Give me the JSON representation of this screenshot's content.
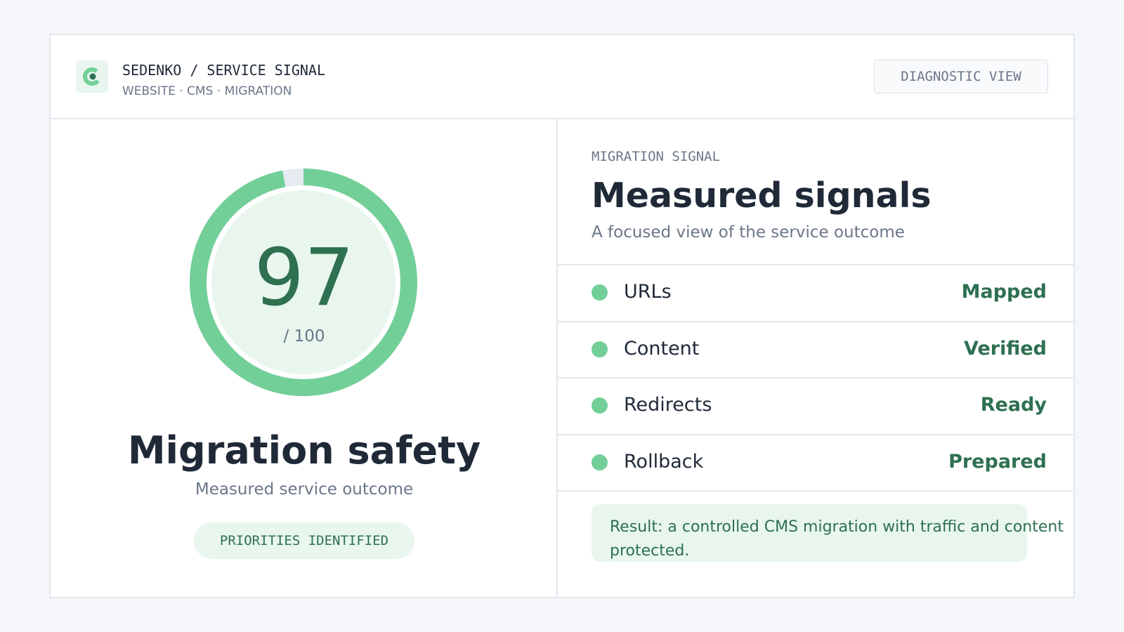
{
  "header": {
    "brand_title": "SEDENKO / SERVICE SIGNAL",
    "brand_subtitle": "WEBSITE · CMS · MIGRATION",
    "diagnostic_button": "DIAGNOSTIC VIEW"
  },
  "score": {
    "value": "97",
    "max_label": "/ 100",
    "fraction": 0.97,
    "title": "Migration safety",
    "subtitle": "Measured service outcome",
    "badge": "PRIORITIES IDENTIFIED"
  },
  "signals_panel": {
    "eyebrow": "MIGRATION SIGNAL",
    "title": "Measured signals",
    "subtitle": "A focused view of the service outcome",
    "rows": [
      {
        "label": "URLs",
        "value": "Mapped"
      },
      {
        "label": "Content",
        "value": "Verified"
      },
      {
        "label": "Redirects",
        "value": "Ready"
      },
      {
        "label": "Rollback",
        "value": "Prepared"
      }
    ],
    "result_line1": "Result: a controlled CMS migration with traffic and content",
    "result_line2": "protected."
  },
  "colors": {
    "accent": "#72cf98",
    "accent_dark": "#2e7050",
    "accent_soft": "#e8f6ee",
    "track": "#e5ebf1"
  },
  "icons": {
    "logo": "c-ring-logo-icon",
    "status_dot": "status-dot-icon"
  }
}
